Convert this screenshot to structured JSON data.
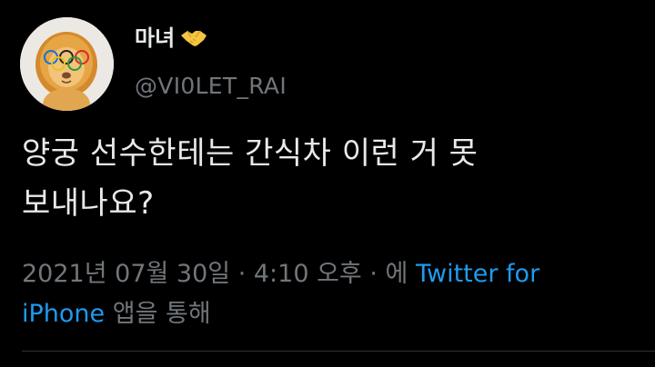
{
  "user": {
    "display_name": "마녀",
    "display_name_emoji": "handshake-icon",
    "handle": "@VI0LET_RAI"
  },
  "tweet": {
    "text_line1": "양궁 선수한테는 간식차 이런 거 못",
    "text_line2": "보내나요?"
  },
  "meta": {
    "timestamp": "2021년 07월 30일",
    "separator1": " · ",
    "time": "4:10 오후",
    "separator2": " · ",
    "via_prefix": "에 ",
    "client_part1": "Twitter for",
    "client_part2": "iPhone",
    "via_suffix": " 앱을 통해"
  },
  "colors": {
    "background": "#000000",
    "text": "#e7e9ea",
    "secondary": "#71767b",
    "link": "#1d9bf0",
    "divider": "#2f3336"
  }
}
